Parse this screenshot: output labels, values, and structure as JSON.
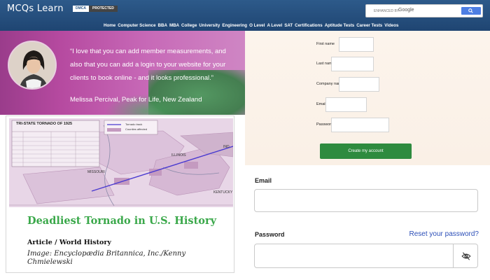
{
  "header": {
    "logo": "MCQs Learn",
    "badge": {
      "dmca": "DMCA",
      "protected": "PROTECTED"
    },
    "search": {
      "enhanced_by": "ENHANCED BY",
      "brand": "Google"
    },
    "nav": [
      "Home",
      "Computer Science",
      "BBA",
      "MBA",
      "College",
      "University",
      "Engineering",
      "O Level",
      "A Level",
      "SAT",
      "Certifications",
      "Aptitude Tests",
      "Career Tests",
      "Videos"
    ]
  },
  "testimonial": {
    "quote": "“I love that you can add member measurements, and also that you can add a login to your website for your clients to book online - and it looks professional.”",
    "author": "Melissa Percival, Peak for Life, New Zealand"
  },
  "article": {
    "map_header": "TRI-STATE TORNADO OF 1925",
    "map_legend": [
      "Tornado track",
      "Counties affected"
    ],
    "map_states": [
      "ILLINOIS",
      "MISSOURI",
      "IND",
      "KENTUCKY"
    ],
    "title": "Deadliest Tornado in U.S. History",
    "subtitle": "Article / World History",
    "credit": "Image: Encyclopædia Britannica, Inc./Kenny Chmielewski"
  },
  "signup": {
    "fields": [
      {
        "label": "First name"
      },
      {
        "label": "Last name"
      },
      {
        "label": "Company name"
      },
      {
        "label": "Email"
      },
      {
        "label": "Password"
      }
    ],
    "submit": "Create my account"
  },
  "login": {
    "email_label": "Email",
    "password_label": "Password",
    "reset_link": "Reset your password?"
  },
  "colors": {
    "header": "#2d5a8a",
    "testimonial": "#b64aa0",
    "article_title": "#3aa84a",
    "create_button": "#2e8b3f",
    "reset_link": "#2c4fb8"
  },
  "icons": [
    "search-icon",
    "eye-slash-icon"
  ]
}
